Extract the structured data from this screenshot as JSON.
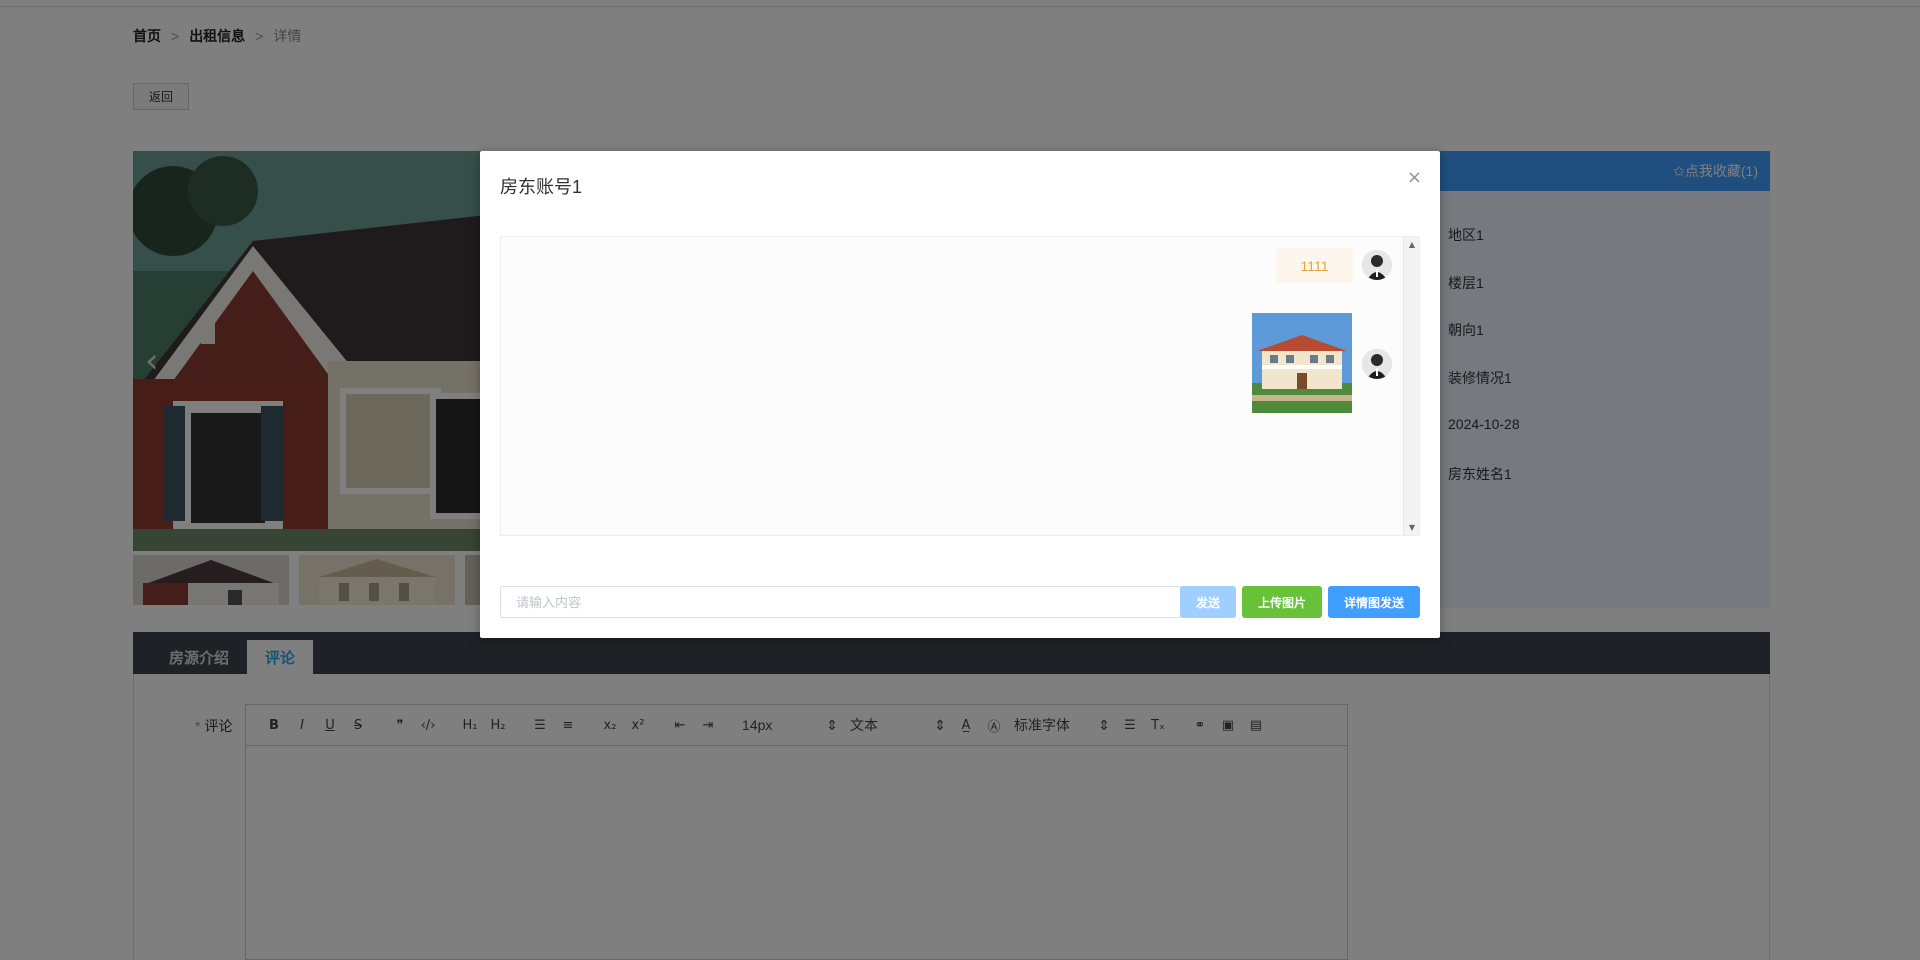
{
  "breadcrumb": {
    "home": "首页",
    "section": "出租信息",
    "current": "详情",
    "sep": ">"
  },
  "back_label": "返回",
  "info": {
    "favorite_label": "✩点我收藏(1)",
    "rows": [
      "地区1",
      "楼层1",
      "朝向1",
      "装修情况1",
      "2024-10-28",
      "房东姓名1"
    ]
  },
  "tabs": [
    {
      "label": "房源介绍"
    },
    {
      "label": "评论"
    }
  ],
  "comment": {
    "label": "评论",
    "required_mark": "*",
    "font_size_select": "14px",
    "text_type_select": "文本",
    "font_family_select": "标准字体"
  },
  "modal": {
    "title": "房东账号1",
    "close_glyph": "×",
    "messages": [
      {
        "type": "text",
        "text": "1111"
      },
      {
        "type": "image"
      }
    ],
    "input_placeholder": "请输入内容",
    "send_label": "发送",
    "upload_label": "上传图片",
    "detail_send_label": "详情图发送"
  },
  "colors": {
    "primary": "#409eff",
    "success": "#67c23a",
    "primary_light": "#a0cfff",
    "warning_text": "#e6a23c",
    "tab_bar": "#3c434a"
  }
}
